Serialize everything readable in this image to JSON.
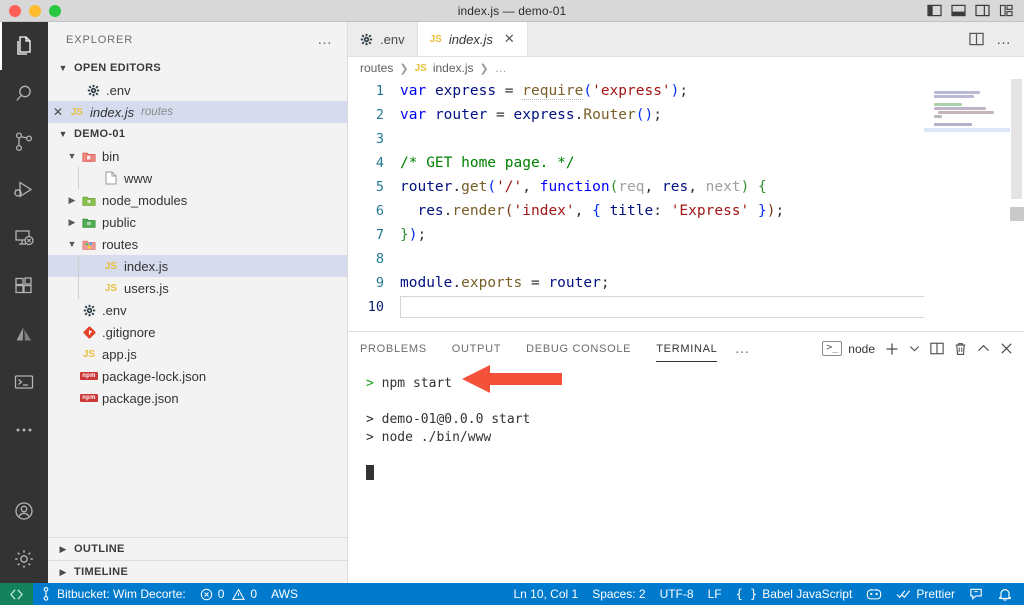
{
  "window": {
    "title": "index.js — demo-01",
    "traffic_lights": [
      "close",
      "minimize",
      "zoom"
    ],
    "layout_buttons": [
      "toggle-primary-sidebar",
      "toggle-panel",
      "toggle-secondary-sidebar",
      "customize-layout"
    ]
  },
  "activity_bar": {
    "items": [
      {
        "name": "explorer",
        "icon": "files-icon",
        "active": true
      },
      {
        "name": "search",
        "icon": "search-icon",
        "active": false
      },
      {
        "name": "source-control",
        "icon": "source-control-icon",
        "active": false
      },
      {
        "name": "run-and-debug",
        "icon": "run-debug-icon",
        "active": false
      },
      {
        "name": "remote-explorer",
        "icon": "remote-explorer-icon",
        "active": false
      },
      {
        "name": "extensions",
        "icon": "extensions-icon",
        "active": false
      },
      {
        "name": "atlassian",
        "icon": "atlassian-icon",
        "active": false
      },
      {
        "name": "terminal",
        "icon": "terminal-icon",
        "active": false
      },
      {
        "name": "more-views",
        "icon": "ellipsis-icon",
        "active": false
      }
    ],
    "bottom_items": [
      {
        "name": "accounts",
        "icon": "account-icon"
      },
      {
        "name": "manage",
        "icon": "gear-icon"
      }
    ]
  },
  "sidebar": {
    "header_title": "EXPLORER",
    "more_actions": "…",
    "open_editors": {
      "label": "OPEN EDITORS",
      "expanded": true,
      "items": [
        {
          "name": ".env",
          "icon": "gear-file-icon",
          "description": "",
          "selected": false,
          "closable": false,
          "italic": false
        },
        {
          "name": "index.js",
          "icon": "js-file-icon",
          "description": "routes",
          "selected": true,
          "closable": true,
          "italic": true
        }
      ]
    },
    "project": {
      "label": "DEMO-01",
      "expanded": true,
      "items": [
        {
          "name": "bin",
          "icon": "folder-bin-icon",
          "depth": 1,
          "type": "folder",
          "expanded": true
        },
        {
          "name": "www",
          "icon": "plain-file-icon",
          "depth": 2,
          "type": "file"
        },
        {
          "name": "node_modules",
          "icon": "folder-node-icon",
          "depth": 1,
          "type": "folder",
          "expanded": false
        },
        {
          "name": "public",
          "icon": "folder-public-icon",
          "depth": 1,
          "type": "folder",
          "expanded": false
        },
        {
          "name": "routes",
          "icon": "folder-routes-icon",
          "depth": 1,
          "type": "folder",
          "expanded": true
        },
        {
          "name": "index.js",
          "icon": "js-file-icon",
          "depth": 2,
          "type": "file",
          "selected": true
        },
        {
          "name": "users.js",
          "icon": "js-file-icon",
          "depth": 2,
          "type": "file"
        },
        {
          "name": ".env",
          "icon": "gear-file-icon",
          "depth": 1,
          "type": "file"
        },
        {
          "name": ".gitignore",
          "icon": "git-file-icon",
          "depth": 1,
          "type": "file"
        },
        {
          "name": "app.js",
          "icon": "js-file-icon",
          "depth": 1,
          "type": "file"
        },
        {
          "name": "package-lock.json",
          "icon": "npm-file-icon",
          "depth": 1,
          "type": "file"
        },
        {
          "name": "package.json",
          "icon": "npm-file-icon",
          "depth": 1,
          "type": "file"
        }
      ]
    },
    "outline": {
      "label": "OUTLINE",
      "expanded": false
    },
    "timeline": {
      "label": "TIMELINE",
      "expanded": false
    }
  },
  "editor": {
    "tabs": [
      {
        "label": ".env",
        "icon": "gear-file-icon",
        "active": false,
        "closable": false,
        "italic": false
      },
      {
        "label": "index.js",
        "icon": "js-file-icon",
        "active": true,
        "closable": true,
        "italic": true
      }
    ],
    "tab_actions": [
      {
        "name": "split-editor",
        "icon": "split-editor-icon"
      },
      {
        "name": "more-editor-actions",
        "icon": "ellipsis-icon"
      }
    ],
    "breadcrumb": [
      "routes",
      "index.js",
      "…"
    ],
    "breadcrumb_file_icon": "js-file-icon",
    "lines": [
      {
        "n": "1",
        "tokens": [
          {
            "t": "var",
            "c": "k-var"
          },
          {
            "t": " ",
            "c": "pun"
          },
          {
            "t": "express",
            "c": "id"
          },
          {
            "t": " = ",
            "c": "pun"
          },
          {
            "t": "require",
            "c": "mem squig"
          },
          {
            "t": "(",
            "c": "brc1"
          },
          {
            "t": "'express'",
            "c": "str"
          },
          {
            "t": ")",
            "c": "brc1"
          },
          {
            "t": ";",
            "c": "pun"
          }
        ]
      },
      {
        "n": "2",
        "tokens": [
          {
            "t": "var",
            "c": "k-var"
          },
          {
            "t": " ",
            "c": "pun"
          },
          {
            "t": "router",
            "c": "id"
          },
          {
            "t": " = ",
            "c": "pun"
          },
          {
            "t": "express",
            "c": "id"
          },
          {
            "t": ".",
            "c": "pun"
          },
          {
            "t": "Router",
            "c": "mem"
          },
          {
            "t": "(",
            "c": "brc1"
          },
          {
            "t": ")",
            "c": "brc1"
          },
          {
            "t": ";",
            "c": "pun"
          }
        ]
      },
      {
        "n": "3",
        "tokens": []
      },
      {
        "n": "4",
        "tokens": [
          {
            "t": "/* GET home page. */",
            "c": "cmt"
          }
        ]
      },
      {
        "n": "5",
        "tokens": [
          {
            "t": "router",
            "c": "id"
          },
          {
            "t": ".",
            "c": "pun"
          },
          {
            "t": "get",
            "c": "mem"
          },
          {
            "t": "(",
            "c": "brc1"
          },
          {
            "t": "'/'",
            "c": "str"
          },
          {
            "t": ", ",
            "c": "pun"
          },
          {
            "t": "function",
            "c": "k-fn"
          },
          {
            "t": "(",
            "c": "brc2"
          },
          {
            "t": "req",
            "c": "param"
          },
          {
            "t": ", ",
            "c": "pun"
          },
          {
            "t": "res",
            "c": "id"
          },
          {
            "t": ", ",
            "c": "pun"
          },
          {
            "t": "next",
            "c": "param"
          },
          {
            "t": ")",
            "c": "brc2"
          },
          {
            "t": " ",
            "c": "pun"
          },
          {
            "t": "{",
            "c": "brc2"
          }
        ]
      },
      {
        "n": "6",
        "tokens": [
          {
            "t": "  ",
            "c": "pun"
          },
          {
            "t": "res",
            "c": "id"
          },
          {
            "t": ".",
            "c": "pun"
          },
          {
            "t": "render",
            "c": "mem"
          },
          {
            "t": "(",
            "c": "brc3"
          },
          {
            "t": "'index'",
            "c": "str"
          },
          {
            "t": ", ",
            "c": "pun"
          },
          {
            "t": "{",
            "c": "brc1"
          },
          {
            "t": " ",
            "c": "pun"
          },
          {
            "t": "title",
            "c": "id"
          },
          {
            "t": ": ",
            "c": "pun"
          },
          {
            "t": "'Express'",
            "c": "str"
          },
          {
            "t": " ",
            "c": "pun"
          },
          {
            "t": "}",
            "c": "brc1"
          },
          {
            "t": ")",
            "c": "brc3"
          },
          {
            "t": ";",
            "c": "pun"
          }
        ]
      },
      {
        "n": "7",
        "tokens": [
          {
            "t": "}",
            "c": "brc2"
          },
          {
            "t": ")",
            "c": "brc1"
          },
          {
            "t": ";",
            "c": "pun"
          }
        ]
      },
      {
        "n": "8",
        "tokens": []
      },
      {
        "n": "9",
        "tokens": [
          {
            "t": "module",
            "c": "id"
          },
          {
            "t": ".",
            "c": "pun"
          },
          {
            "t": "exports",
            "c": "mem"
          },
          {
            "t": " = ",
            "c": "pun"
          },
          {
            "t": "router",
            "c": "id"
          },
          {
            "t": ";",
            "c": "pun"
          }
        ]
      },
      {
        "n": "10",
        "tokens": [],
        "current": true
      }
    ]
  },
  "panel": {
    "tabs": [
      {
        "label": "PROBLEMS",
        "active": false
      },
      {
        "label": "OUTPUT",
        "active": false
      },
      {
        "label": "DEBUG CONSOLE",
        "active": false
      },
      {
        "label": "TERMINAL",
        "active": true
      }
    ],
    "more_tabs": "…",
    "terminal_name": "node",
    "actions": [
      {
        "name": "new-terminal",
        "icon": "plus-icon"
      },
      {
        "name": "terminal-dropdown",
        "icon": "chevron-down-icon"
      },
      {
        "name": "split-terminal",
        "icon": "split-icon"
      },
      {
        "name": "kill-terminal",
        "icon": "trash-icon"
      },
      {
        "name": "maximize-panel",
        "icon": "chevron-up-icon"
      },
      {
        "name": "close-panel",
        "icon": "close-icon"
      }
    ],
    "terminal_lines": [
      {
        "prompt": "> ",
        "text": "npm start",
        "prompt_green": true
      },
      {
        "prompt": "",
        "text": ""
      },
      {
        "prompt": "> ",
        "text": "demo-01@0.0.0 start",
        "prompt_green": false
      },
      {
        "prompt": "> ",
        "text": "node ./bin/www",
        "prompt_green": false
      },
      {
        "prompt": "",
        "text": ""
      }
    ],
    "cursor_visible": true
  },
  "annotation": {
    "type": "arrow",
    "color": "#f4513b",
    "points_at": "npm start"
  },
  "status_bar": {
    "remote_label": "",
    "remote_icon": "remote-icon",
    "left_items": [
      {
        "name": "source-control-branch",
        "icon": "git-branch-icon",
        "label": "Bitbucket: Wim Decorte:"
      },
      {
        "name": "problems",
        "icon": "error-warning-icon",
        "label": "0  0",
        "error_count": "0",
        "warning_count": "0"
      },
      {
        "name": "aws",
        "icon": "",
        "label": "AWS"
      }
    ],
    "right_items": [
      {
        "name": "cursor-position",
        "label": "Ln 10, Col 1"
      },
      {
        "name": "indentation",
        "label": "Spaces: 2"
      },
      {
        "name": "encoding",
        "label": "UTF-8"
      },
      {
        "name": "eol",
        "label": "LF"
      },
      {
        "name": "language-mode",
        "icon": "braces-icon",
        "label": "Babel JavaScript"
      },
      {
        "name": "live-share",
        "icon": "live-share-icon",
        "label": ""
      },
      {
        "name": "prettier",
        "icon": "checkmarks-icon",
        "label": "Prettier"
      },
      {
        "name": "feedback",
        "icon": "feedback-icon",
        "label": ""
      },
      {
        "name": "notifications",
        "icon": "bell-icon",
        "label": ""
      }
    ]
  },
  "colors": {
    "accent": "#007acc",
    "remote_green": "#16825d",
    "activity_bar": "#333333",
    "sidebar_bg": "#f3f3f3",
    "selection": "#d6dbee",
    "annotation_red": "#f4513b",
    "js_yellow": "#e8bf3e",
    "npm_red": "#cb3837"
  }
}
